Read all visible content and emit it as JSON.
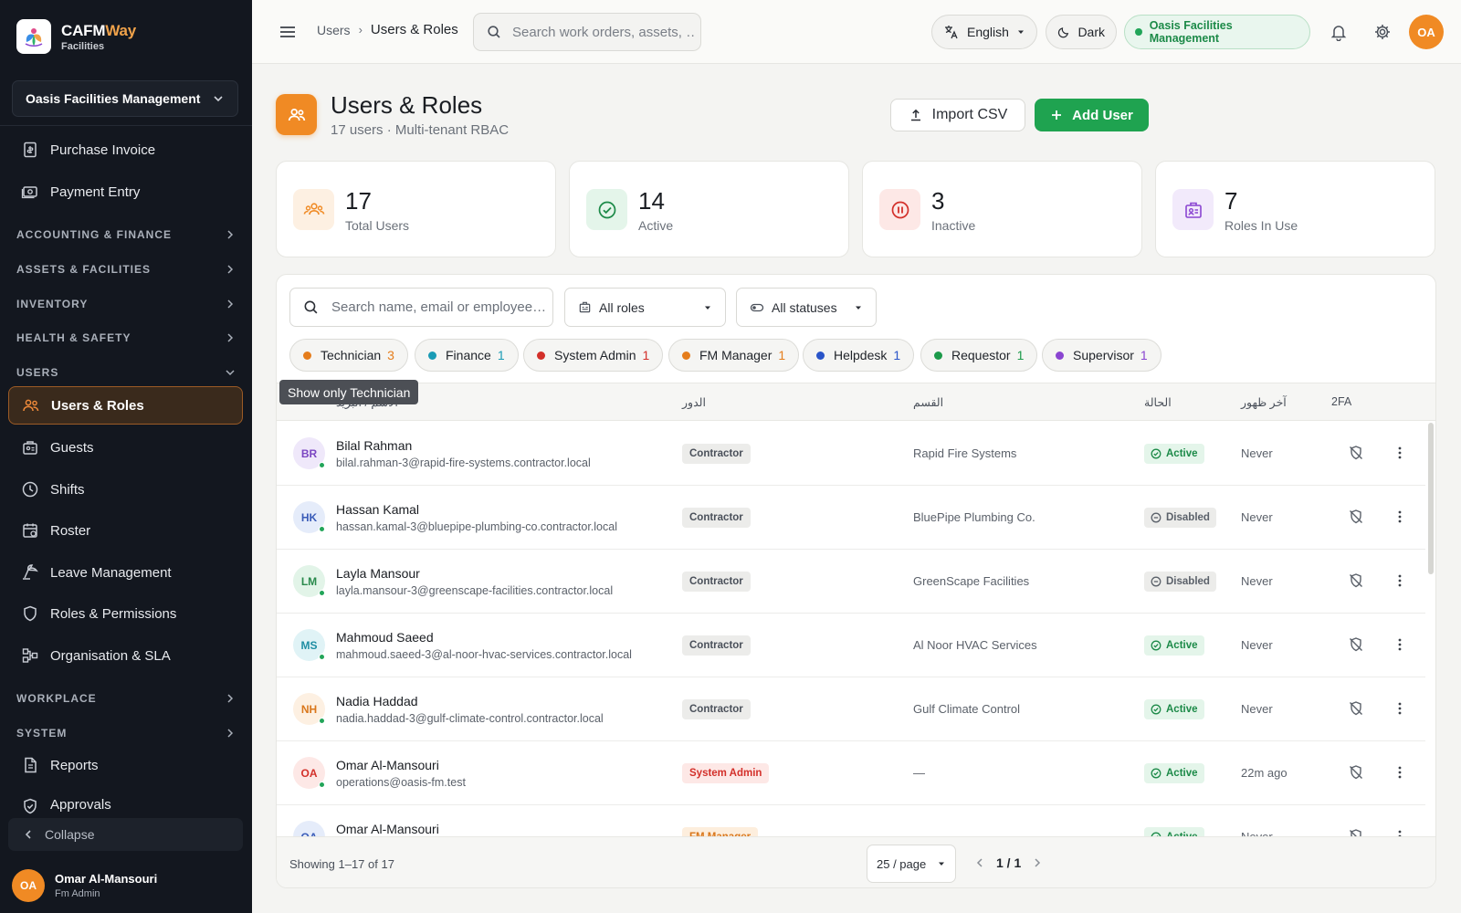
{
  "brand": {
    "name_main": "CAFM",
    "name_accent": "Way",
    "sub": "Facilities"
  },
  "sidebar": {
    "org_select": "Oasis Facilities Management",
    "items_top": [
      {
        "label": "Purchase Invoice",
        "icon": "invoice-icon"
      },
      {
        "label": "Payment Entry",
        "icon": "payment-icon"
      }
    ],
    "groups": [
      {
        "label": "ACCOUNTING & FINANCE"
      },
      {
        "label": "ASSETS & FACILITIES"
      },
      {
        "label": "INVENTORY"
      },
      {
        "label": "HEALTH & SAFETY"
      },
      {
        "label": "USERS"
      }
    ],
    "users_items": [
      {
        "label": "Users & Roles",
        "icon": "users-icon",
        "active": true
      },
      {
        "label": "Guests",
        "icon": "guests-icon"
      },
      {
        "label": "Shifts",
        "icon": "clock-icon"
      },
      {
        "label": "Roster",
        "icon": "calendar-icon"
      },
      {
        "label": "Leave Management",
        "icon": "leave-icon"
      },
      {
        "label": "Roles & Permissions",
        "icon": "shield-icon"
      },
      {
        "label": "Organisation & SLA",
        "icon": "org-icon"
      }
    ],
    "groups_bottom": [
      {
        "label": "WORKPLACE"
      },
      {
        "label": "SYSTEM"
      }
    ],
    "items_bottom": [
      {
        "label": "Reports",
        "icon": "reports-icon"
      },
      {
        "label": "Approvals",
        "icon": "approvals-icon"
      }
    ],
    "collapse": "Collapse",
    "user": {
      "initials": "OA",
      "name": "Omar Al-Mansouri",
      "role": "Fm Admin"
    }
  },
  "topbar": {
    "breadcrumb": [
      "Users",
      "Users & Roles"
    ],
    "search_placeholder": "Search work orders, assets, …",
    "language": "English",
    "theme": "Dark",
    "org": "Oasis Facilities Management",
    "avatar": "OA"
  },
  "page": {
    "title": "Users & Roles",
    "subtitle": "17 users · Multi-tenant RBAC",
    "import_label": "Import CSV",
    "add_label": "Add User"
  },
  "stats": [
    {
      "value": "17",
      "label": "Total Users",
      "color": "#f08a24",
      "bg": "#fdf0e2"
    },
    {
      "value": "14",
      "label": "Active",
      "color": "#1c8a48",
      "bg": "#e4f5ea"
    },
    {
      "value": "3",
      "label": "Inactive",
      "color": "#d3302a",
      "bg": "#fde8e6"
    },
    {
      "value": "7",
      "label": "Roles In Use",
      "color": "#8a45d1",
      "bg": "#f2eafb"
    }
  ],
  "filters": {
    "search_placeholder": "Search name, email or employee…",
    "roles": "All roles",
    "statuses": "All statuses"
  },
  "chips": [
    {
      "label": "Technician",
      "count": "3",
      "color": "#e57d1c"
    },
    {
      "label": "Finance",
      "count": "1",
      "color": "#1a9bb5"
    },
    {
      "label": "System Admin",
      "count": "1",
      "color": "#d3302a"
    },
    {
      "label": "FM Manager",
      "count": "1",
      "color": "#e57d1c"
    },
    {
      "label": "Helpdesk",
      "count": "1",
      "color": "#2a55c9"
    },
    {
      "label": "Requestor",
      "count": "1",
      "color": "#1c9a4a"
    },
    {
      "label": "Supervisor",
      "count": "1",
      "color": "#8a45d1"
    }
  ],
  "tooltip": "Show only Technician",
  "table": {
    "headers": {
      "name": "الاسم / البريد",
      "role": "الدور",
      "dept": "القسم",
      "status": "الحالة",
      "last_seen": "آخر ظهور",
      "tfa": "2FA"
    },
    "rows": [
      {
        "initials": "BR",
        "av_bg": "#efe8fa",
        "av_fg": "#7b46c2",
        "name": "Bilal Rahman",
        "email": "bilal.rahman-3@rapid-fire-systems.contractor.local",
        "role": "Contractor",
        "role_class": "contractor",
        "dept": "Rapid Fire Systems",
        "status": "Active",
        "status_class": "active",
        "last_seen": "Never"
      },
      {
        "initials": "HK",
        "av_bg": "#e5ecfa",
        "av_fg": "#3a5cb8",
        "name": "Hassan Kamal",
        "email": "hassan.kamal-3@bluepipe-plumbing-co.contractor.local",
        "role": "Contractor",
        "role_class": "contractor",
        "dept": "BluePipe Plumbing Co.",
        "status": "Disabled",
        "status_class": "disabled",
        "last_seen": "Never"
      },
      {
        "initials": "LM",
        "av_bg": "#e2f4e8",
        "av_fg": "#2a8a4c",
        "name": "Layla Mansour",
        "email": "layla.mansour-3@greenscape-facilities.contractor.local",
        "role": "Contractor",
        "role_class": "contractor",
        "dept": "GreenScape Facilities",
        "status": "Disabled",
        "status_class": "disabled",
        "last_seen": "Never"
      },
      {
        "initials": "MS",
        "av_bg": "#e0f3f6",
        "av_fg": "#1f8ea3",
        "name": "Mahmoud Saeed",
        "email": "mahmoud.saeed-3@al-noor-hvac-services.contractor.local",
        "role": "Contractor",
        "role_class": "contractor",
        "dept": "Al Noor HVAC Services",
        "status": "Active",
        "status_class": "active",
        "last_seen": "Never"
      },
      {
        "initials": "NH",
        "av_bg": "#fdf0e2",
        "av_fg": "#d9771c",
        "name": "Nadia Haddad",
        "email": "nadia.haddad-3@gulf-climate-control.contractor.local",
        "role": "Contractor",
        "role_class": "contractor",
        "dept": "Gulf Climate Control",
        "status": "Active",
        "status_class": "active",
        "last_seen": "Never"
      },
      {
        "initials": "OA",
        "av_bg": "#fde8e6",
        "av_fg": "#d3302a",
        "name": "Omar Al-Mansouri",
        "email": "operations@oasis-fm.test",
        "role": "System Admin",
        "role_class": "sysadmin",
        "dept": "—",
        "status": "Active",
        "status_class": "active",
        "last_seen": "22m ago"
      },
      {
        "initials": "OA",
        "av_bg": "#e5ecfa",
        "av_fg": "#3a5cb8",
        "name": "Omar Al-Mansouri",
        "email": "",
        "role": "FM Manager",
        "role_class": "fm",
        "dept": "—",
        "status": "Active",
        "status_class": "active",
        "last_seen": "Never"
      }
    ]
  },
  "footer": {
    "showing": "Showing 1–17 of 17",
    "per_page": "25 / page",
    "page_indicator": "1 / 1"
  }
}
